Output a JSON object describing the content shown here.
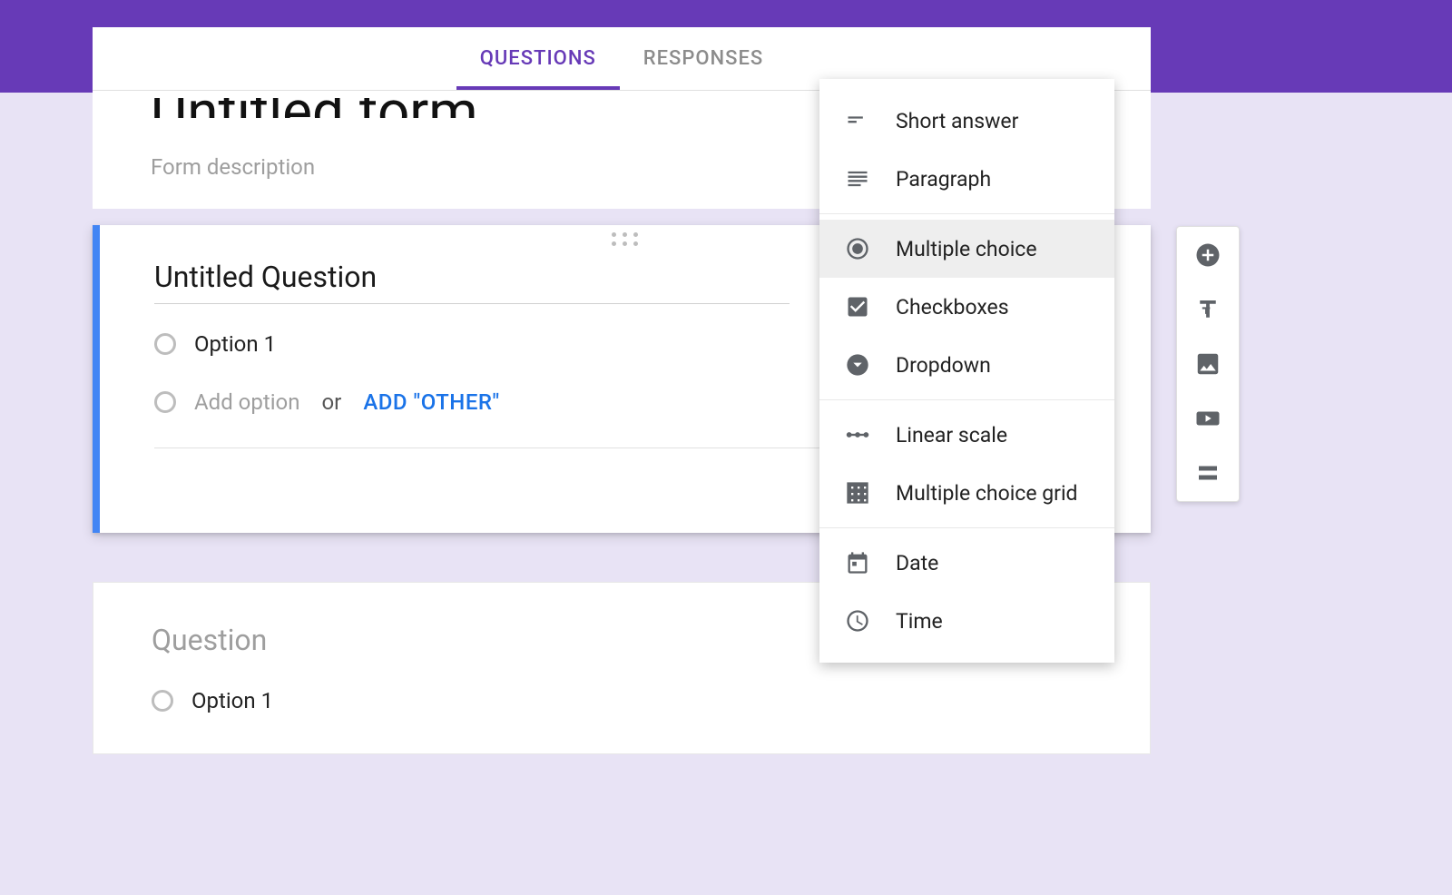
{
  "tabs": {
    "questions": "QUESTIONS",
    "responses": "RESPONSES"
  },
  "header": {
    "title": "Untitled form",
    "description_placeholder": "Form description"
  },
  "active_question": {
    "title": "Untitled Question",
    "option1": "Option 1",
    "add_option_placeholder": "Add option",
    "or_text": "or",
    "add_other": "ADD \"OTHER\""
  },
  "question2": {
    "title": "Question",
    "option1": "Option 1"
  },
  "type_menu": {
    "short_answer": "Short answer",
    "paragraph": "Paragraph",
    "multiple_choice": "Multiple choice",
    "checkboxes": "Checkboxes",
    "dropdown": "Dropdown",
    "linear_scale": "Linear scale",
    "multiple_choice_grid": "Multiple choice grid",
    "date": "Date",
    "time": "Time"
  }
}
